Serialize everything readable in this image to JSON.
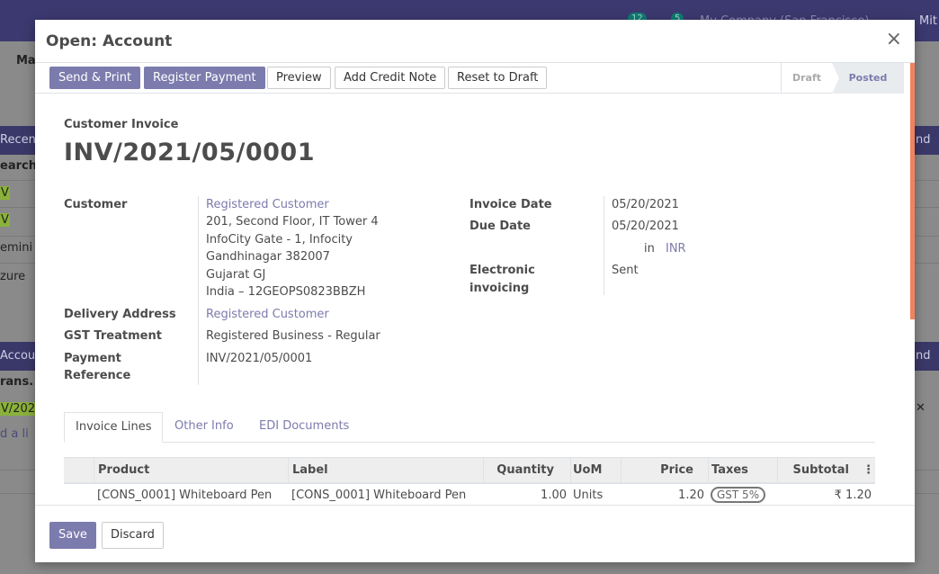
{
  "background": {
    "badges": [
      "12",
      "5"
    ],
    "band1_label": "Recent",
    "band1_right": "nd",
    "band2_label": "Accou",
    "band2_right": "nd",
    "col_label": "earch",
    "rows": [
      "V",
      "V",
      "emini",
      "zure"
    ],
    "trans_label": "rans.",
    "row_nv": "V/202",
    "add_line": "d a li",
    "left_label": "Ma",
    "close_x": "✕",
    "user": "Mit",
    "company": "My Company (San Francisco)"
  },
  "modal": {
    "title": "Open: Account",
    "close_icon": "×"
  },
  "statusbar": {
    "buttons": {
      "send_print": "Send & Print",
      "register_payment": "Register Payment",
      "preview": "Preview",
      "add_credit_note": "Add Credit Note",
      "reset_to_draft": "Reset to Draft"
    },
    "stages": {
      "draft": "Draft",
      "posted": "Posted"
    },
    "active_stage": "Posted"
  },
  "invoice": {
    "doc_type": "Customer Invoice",
    "name": "INV/2021/05/0001",
    "customer_label": "Customer",
    "customer_name": "Registered Customer",
    "address": [
      "201, Second Floor, IT Tower 4",
      "InfoCity Gate - 1, Infocity",
      "Gandhinagar 382007",
      "Gujarat GJ",
      "India – 12GEOPS0823BBZH"
    ],
    "delivery_label": "Delivery Address",
    "delivery_value": "Registered Customer",
    "gst_label": "GST Treatment",
    "gst_value": "Registered Business - Regular",
    "payref_label_1": "Payment",
    "payref_label_2": "Reference",
    "payref_value": "INV/2021/05/0001",
    "invoice_date_label": "Invoice Date",
    "invoice_date_value": "05/20/2021",
    "due_date_label": "Due Date",
    "due_date_value": "05/20/2021",
    "currency_in": "in",
    "currency": "INR",
    "einv_label_1": "Electronic",
    "einv_label_2": "invoicing",
    "einv_value": "Sent"
  },
  "tabs": [
    "Invoice Lines",
    "Other Info",
    "EDI Documents"
  ],
  "lines": {
    "columns": [
      "Product",
      "Label",
      "Quantity",
      "UoM",
      "Price",
      "Taxes",
      "Subtotal"
    ],
    "options_icon": "⋮",
    "rows": [
      {
        "product": "[CONS_0001] Whiteboard Pen",
        "label": "[CONS_0001] Whiteboard Pen",
        "quantity": "1.00",
        "uom": "Units",
        "price": "1.20",
        "tax": "GST 5%",
        "subtotal": "₹ 1.20"
      }
    ]
  },
  "footer": {
    "save": "Save",
    "discard": "Discard"
  },
  "colors": {
    "primary": "#7c7bad",
    "navbar": "#3c3970",
    "scroll_accent": "#f0825f"
  }
}
